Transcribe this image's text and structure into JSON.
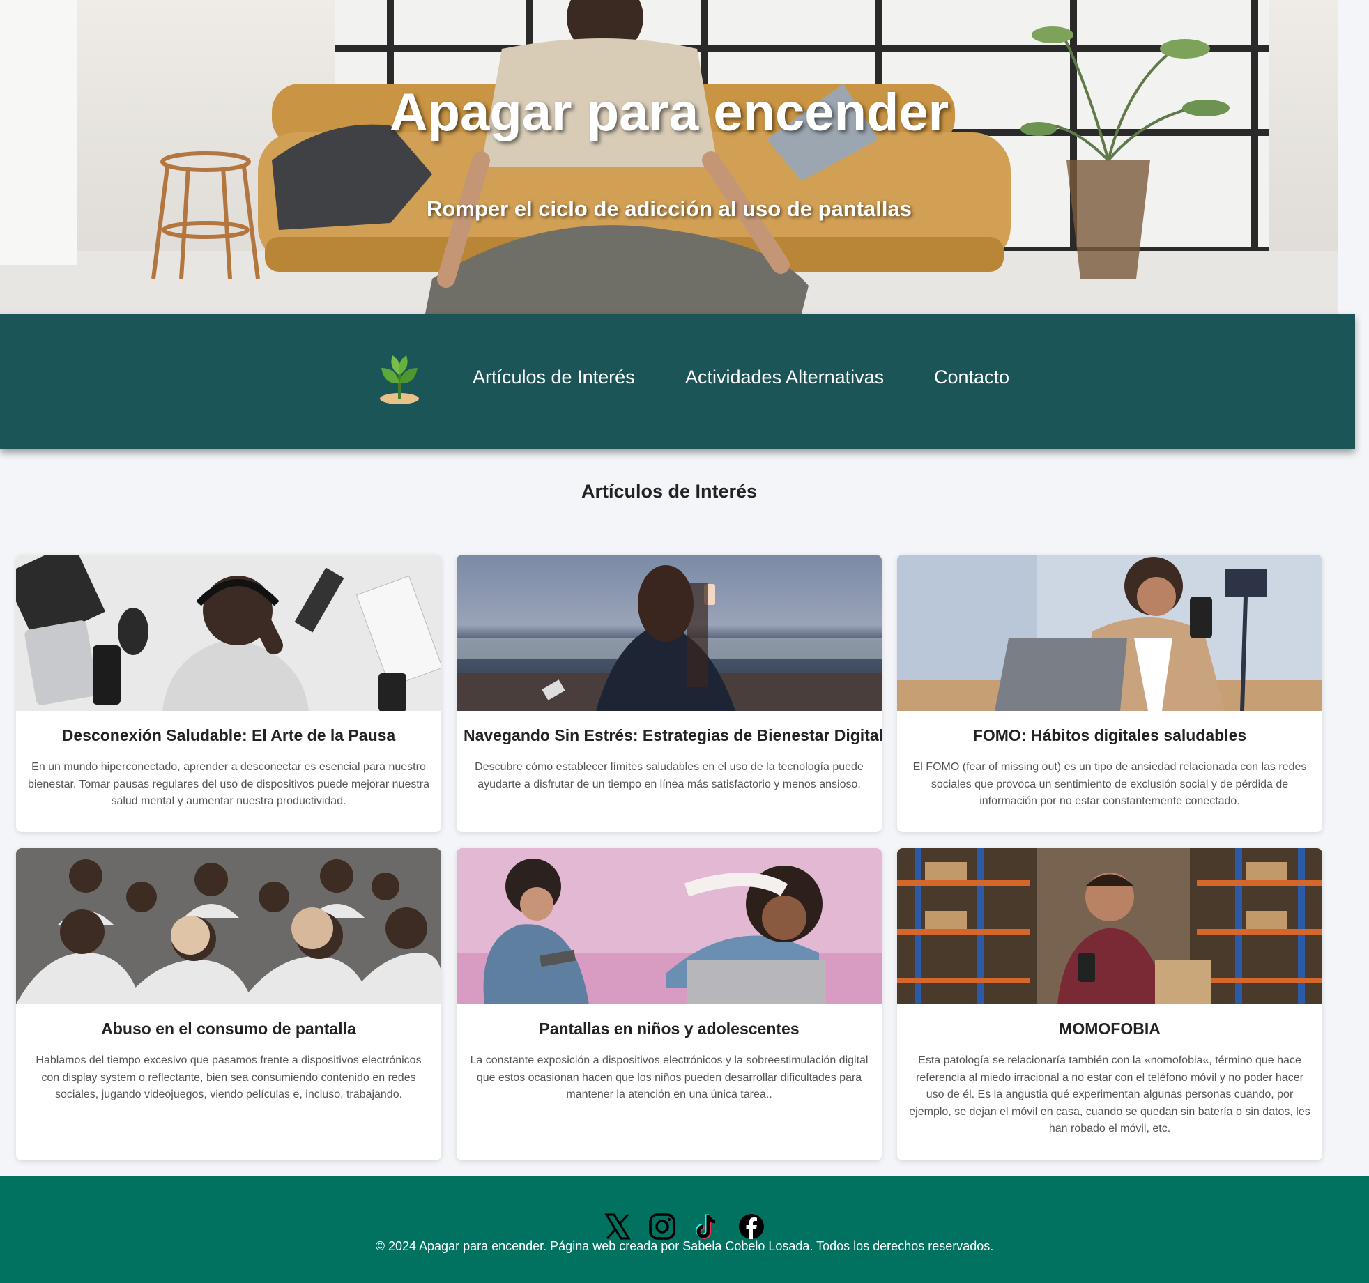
{
  "hero": {
    "title": "Apagar para encender",
    "subtitle": "Romper el ciclo de adicción al uso de pantallas"
  },
  "nav": {
    "logo_icon": "plant-sprout-icon",
    "links": [
      {
        "label": "Artículos de Interés"
      },
      {
        "label": "Actividades Alternativas"
      },
      {
        "label": "Contacto"
      }
    ]
  },
  "articles": {
    "heading": "Artículos de Interés",
    "cards": [
      {
        "title": "Desconexión Saludable: El Arte de la Pausa",
        "text": "En un mundo hiperconectado, aprender a desconectar es esencial para nuestro bienestar. Tomar pausas regulares del uso de dispositivos puede mejorar nuestra salud mental y aumentar nuestra productividad."
      },
      {
        "title": "Navegando Sin Estrés: Estrategias de Bienestar Digital",
        "text": "Descubre cómo establecer límites saludables en el uso de la tecnología puede ayudarte a disfrutar de un tiempo en línea más satisfactorio y menos ansioso."
      },
      {
        "title": "FOMO: Hábitos digitales saludables",
        "text": "El FOMO (fear of missing out) es un tipo de ansiedad relacionada con las redes sociales que provoca un sentimiento de exclusión social y de pérdida de información por no estar constantemente conectado."
      },
      {
        "title": "Abuso en el consumo de pantalla",
        "text": "Hablamos del tiempo excesivo que pasamos frente a dispositivos electrónicos con display system o reflectante, bien sea consumiendo contenido en redes sociales, jugando videojuegos, viendo películas e, incluso, trabajando."
      },
      {
        "title": "Pantallas en niños y adolescentes",
        "text": "La constante exposición a dispositivos electrónicos y la sobreestimulación digital que estos ocasionan hacen que los niños pueden desarrollar dificultades para mantener la atención en una única tarea.."
      },
      {
        "title": "MOMOFOBIA",
        "text": "Esta patología se relacionaría también con la «nomofobia«, término que hace referencia al miedo irracional a no estar con el teléfono móvil y no poder hacer uso de él. Es la angustia qué experimentan algunas personas cuando, por ejemplo, se dejan el móvil en casa, cuando se quedan sin batería o sin datos, les han robado el móvil, etc."
      }
    ]
  },
  "footer": {
    "social_icons": [
      "x-twitter-icon",
      "instagram-icon",
      "tiktok-icon",
      "facebook-icon"
    ],
    "copyright": "© 2024 Apagar para encender. Página web creada por Sabela Cobelo Losada. Todos los derechos reservados."
  },
  "colors": {
    "nav_bg": "#1b5557",
    "footer_bg": "#00725f",
    "page_bg": "#f4f5f9"
  }
}
